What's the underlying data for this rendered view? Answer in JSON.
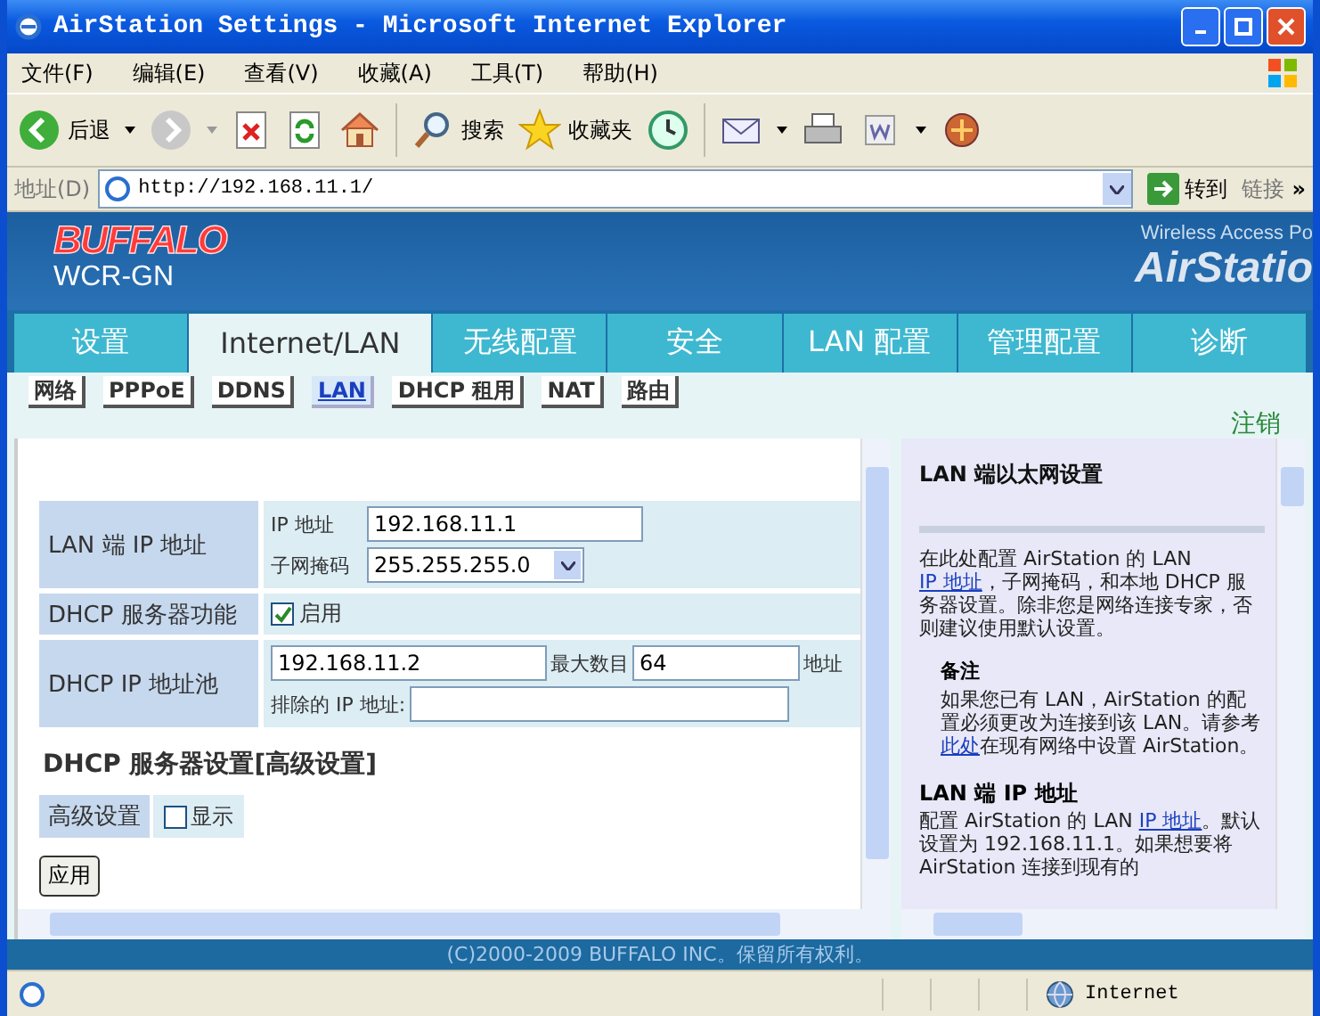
{
  "window": {
    "title": "AirStation Settings - Microsoft Internet Explorer"
  },
  "menu": [
    "文件(F)",
    "编辑(E)",
    "查看(V)",
    "收藏(A)",
    "工具(T)",
    "帮助(H)"
  ],
  "toolbar": {
    "back": "后退",
    "search": "搜索",
    "favorites": "收藏夹"
  },
  "address_bar": {
    "label": "地址(D)",
    "value": "http://192.168.11.1/",
    "go": "转到",
    "links": "链接",
    "more": "»"
  },
  "header": {
    "brand": "BUFFALO",
    "model": "WCR-GN",
    "tagline": "Wireless Access Po",
    "product": "AirStatio"
  },
  "tabs": [
    {
      "label": "设置",
      "selected": false
    },
    {
      "label": "Internet/LAN",
      "selected": true
    },
    {
      "label": "无线配置",
      "selected": false
    },
    {
      "label": "安全",
      "selected": false
    },
    {
      "label": "LAN 配置",
      "selected": false
    },
    {
      "label": "管理配置",
      "selected": false
    },
    {
      "label": "诊断",
      "selected": false
    }
  ],
  "subtabs": [
    {
      "label": "网络",
      "selected": false
    },
    {
      "label": "PPPoE",
      "selected": false
    },
    {
      "label": "DDNS",
      "selected": false
    },
    {
      "label": "LAN",
      "selected": true
    },
    {
      "label": "DHCP 租用",
      "selected": false
    },
    {
      "label": "NAT",
      "selected": false
    },
    {
      "label": "路由",
      "selected": false
    }
  ],
  "logout": "注销",
  "form": {
    "lan_ip": {
      "label": "LAN 端 IP 地址",
      "ip_label": "IP 地址",
      "ip_value": "192.168.11.1",
      "mask_label": "子网掩码",
      "mask_value": "255.255.255.0"
    },
    "dhcp_server": {
      "label": "DHCP 服务器功能",
      "enable_label": "启用",
      "checked": true
    },
    "dhcp_pool": {
      "label": "DHCP IP 地址池",
      "start": "192.168.11.2",
      "max_label": "最大数目",
      "max": "64",
      "unit": "地址",
      "exclude_label": "排除的 IP 地址:"
    }
  },
  "advanced": {
    "heading": "DHCP 服务器设置[高级设置]",
    "label": "高级设置",
    "show_label": "显示",
    "checked": false
  },
  "apply": "应用",
  "help": {
    "blocks": [
      {
        "kind": "title",
        "text": "LAN 端以太网设置"
      },
      {
        "kind": "paragraph",
        "parts": [
          {
            "kind": "text",
            "text": "在此处配置 AirStation 的 LAN "
          },
          {
            "kind": "link",
            "text": "IP 地址"
          },
          {
            "kind": "text",
            "text": "，子网掩码，和本地 DHCP 服务器设置。除非您是网络连接专家，否则建议使用默认设置。"
          }
        ]
      },
      {
        "kind": "note_heading",
        "text": "备注"
      },
      {
        "kind": "note",
        "parts": [
          {
            "kind": "text",
            "text": "如果您已有 LAN，AirStation 的配置必须更改为连接到该 LAN。请参考"
          },
          {
            "kind": "link",
            "text": "此处"
          },
          {
            "kind": "text",
            "text": "在现有网络中设置 AirStation。"
          }
        ]
      },
      {
        "kind": "heading",
        "text": "LAN 端 IP 地址"
      },
      {
        "kind": "paragraph",
        "parts": [
          {
            "kind": "text",
            "text": "配置 AirStation 的 LAN "
          },
          {
            "kind": "link",
            "text": "IP 地址"
          },
          {
            "kind": "text",
            "text": "。默认设置为 192.168.11.1。如果想要将 AirStation 连接到现有的"
          }
        ]
      }
    ]
  },
  "footer": "(C)2000-2009 BUFFALO INC。保留所有权利。",
  "status_bar": {
    "zone": "Internet"
  }
}
